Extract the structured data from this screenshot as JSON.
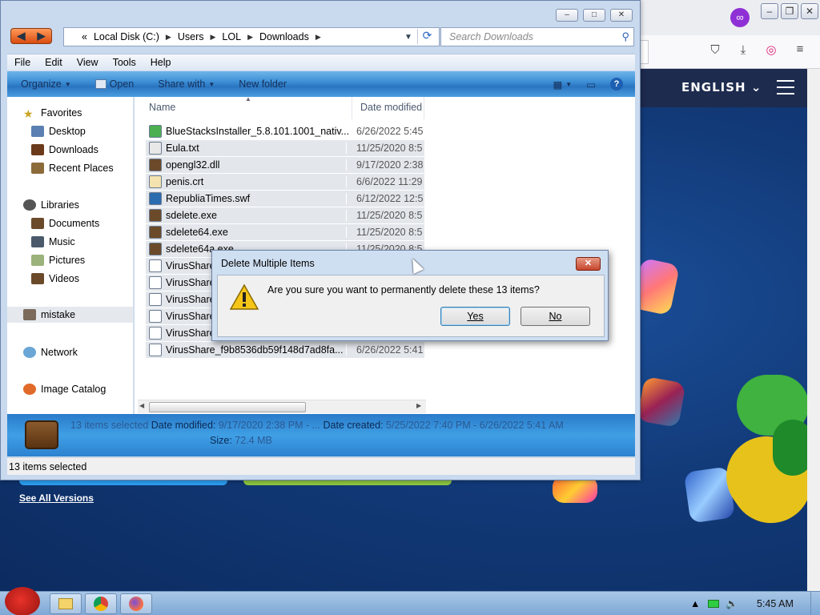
{
  "browser": {
    "language_label": "ENGLISH",
    "see_all_label": "See All Versions"
  },
  "explorer": {
    "breadcrumb": [
      "Local Disk (C:)",
      "Users",
      "LOL",
      "Downloads"
    ],
    "breadcrumb_prefix": "«",
    "search_placeholder": "Search Downloads",
    "menu": [
      "File",
      "Edit",
      "View",
      "Tools",
      "Help"
    ],
    "commands": {
      "organize": "Organize",
      "open": "Open",
      "share_with": "Share with",
      "new_folder": "New folder"
    },
    "nav": {
      "favorites": "Favorites",
      "desktop": "Desktop",
      "downloads": "Downloads",
      "recent_places": "Recent Places",
      "libraries": "Libraries",
      "documents": "Documents",
      "music": "Music",
      "pictures": "Pictures",
      "videos": "Videos",
      "mistake": "mistake",
      "network": "Network",
      "image_catalog": "Image Catalog"
    },
    "columns": {
      "name": "Name",
      "date_modified": "Date modified"
    },
    "files": [
      {
        "name": "BlueStacksInstaller_5.8.101.1001_nativ...",
        "date": "6/26/2022 5:45",
        "icon": "bluestacks-icon",
        "color": "#4caf50"
      },
      {
        "name": "Eula.txt",
        "date": "11/25/2020 8:5",
        "icon": "text-file-icon",
        "color": "#e8e8e8"
      },
      {
        "name": "opengl32.dll",
        "date": "9/17/2020 2:38",
        "icon": "dll-file-icon",
        "color": "#6b4a2a"
      },
      {
        "name": "penis.crt",
        "date": "6/6/2022 11:29",
        "icon": "certificate-icon",
        "color": "#f3e3b0"
      },
      {
        "name": "RepubliaTimes.swf",
        "date": "6/12/2022 12:5",
        "icon": "flash-file-icon",
        "color": "#2b6cb0"
      },
      {
        "name": "sdelete.exe",
        "date": "11/25/2020 8:5",
        "icon": "exe-file-icon",
        "color": "#6b4a2a"
      },
      {
        "name": "sdelete64.exe",
        "date": "11/25/2020 8:5",
        "icon": "exe-file-icon",
        "color": "#6b4a2a"
      },
      {
        "name": "sdelete64a.exe",
        "date": "11/25/2020 8:5",
        "icon": "exe-file-icon",
        "color": "#6b4a2a"
      },
      {
        "name": "VirusShare",
        "date": "",
        "icon": "virusshare-file-icon",
        "color": "#ffffff"
      },
      {
        "name": "VirusShare",
        "date": "",
        "icon": "virusshare-file-icon",
        "color": "#ffffff"
      },
      {
        "name": "VirusShare",
        "date": "",
        "icon": "virusshare-file-icon",
        "color": "#ffffff"
      },
      {
        "name": "VirusShare",
        "date": "",
        "icon": "virusshare-file-icon",
        "color": "#ffffff"
      },
      {
        "name": "VirusShare",
        "date": "",
        "icon": "virusshare-file-icon",
        "color": "#ffffff"
      },
      {
        "name": "VirusShare_f9b8536db59f148d7ad8fa...",
        "date": "6/26/2022 5:41",
        "icon": "virusshare-file-icon",
        "color": "#ffffff"
      }
    ],
    "details": {
      "selected": "13 items selected",
      "date_modified_label": "Date modified:",
      "date_modified_value": "9/17/2020 2:38 PM - ...",
      "date_created_label": "Date created:",
      "date_created_value": "5/25/2022 7:40 PM - 6/26/2022 5:41 AM",
      "size_label": "Size:",
      "size_value": "72.4 MB"
    },
    "status": "13 items selected"
  },
  "dialog": {
    "title": "Delete Multiple Items",
    "message": "Are you sure you want to permanently delete these 13 items?",
    "yes": "Yes",
    "no": "No"
  },
  "taskbar": {
    "clock": "5:45 AM"
  },
  "colors": {
    "accent": "#3d8fd6",
    "browser_bg": "#123a78",
    "warning": "#f5c518"
  }
}
